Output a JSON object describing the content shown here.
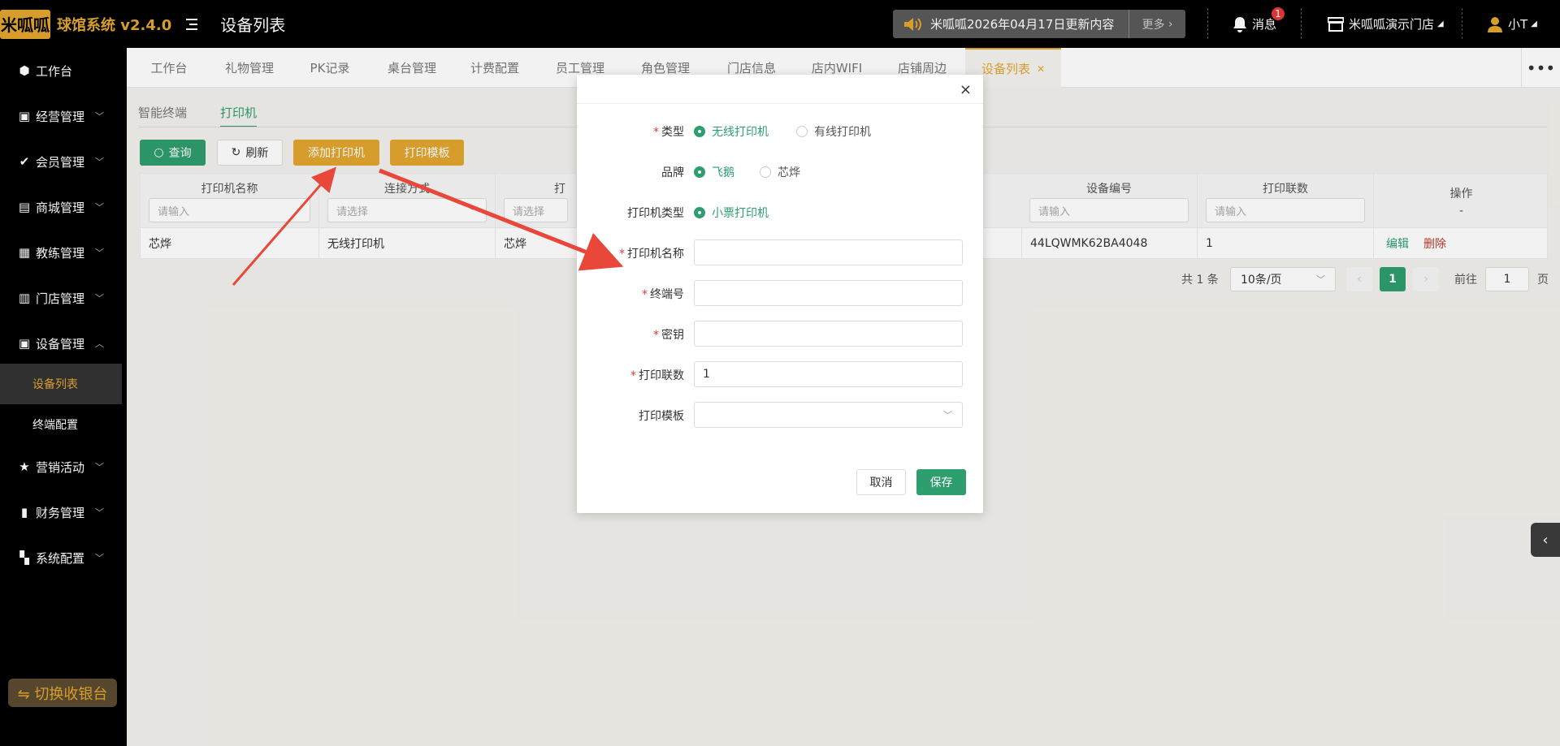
{
  "header": {
    "logo_text": "米呱呱",
    "app_title": "球馆系统 v2.4.0",
    "page_title": "设备列表",
    "notice_text": "米呱呱2026年04月17日更新内容",
    "notice_more": "更多",
    "messages_label": "消息",
    "messages_badge": "1",
    "store_label": "米呱呱演示门店",
    "user_label": "小T"
  },
  "sidebar": {
    "items": [
      {
        "label": "工作台",
        "icon": "cube-icon"
      },
      {
        "label": "经营管理",
        "icon": "chart-icon"
      },
      {
        "label": "会员管理",
        "icon": "member-icon"
      },
      {
        "label": "商城管理",
        "icon": "mall-icon"
      },
      {
        "label": "教练管理",
        "icon": "coach-icon"
      },
      {
        "label": "门店管理",
        "icon": "store-icon"
      },
      {
        "label": "设备管理",
        "icon": "device-icon"
      }
    ],
    "sub_items": [
      "设备列表",
      "终端配置"
    ],
    "items_after": [
      {
        "label": "营销活动",
        "icon": "star-icon"
      },
      {
        "label": "财务管理",
        "icon": "finance-icon"
      },
      {
        "label": "系统配置",
        "icon": "grid-icon"
      }
    ],
    "switch_label": "⇋ 切换收银台"
  },
  "tabs": [
    "工作台",
    "礼物管理",
    "PK记录",
    "桌台管理",
    "计费配置",
    "员工管理",
    "角色管理",
    "门店信息",
    "店内WIFI",
    "店铺周边",
    "设备列表"
  ],
  "subtabs": [
    "智能终端",
    "打印机"
  ],
  "toolbar": {
    "query": "查询",
    "refresh": "刷新",
    "add_printer": "添加打印机",
    "print_template": "打印模板"
  },
  "table": {
    "columns": [
      {
        "title": "打印机名称",
        "placeholder": "请输入"
      },
      {
        "title": "连接方式",
        "placeholder": "请选择"
      },
      {
        "title": "打印",
        "placeholder": "请选择"
      },
      {
        "title": "设备编号",
        "placeholder": "请输入"
      },
      {
        "title": "打印联数",
        "placeholder": "请输入"
      },
      {
        "title": "操作",
        "placeholder": "-"
      }
    ],
    "rows": [
      {
        "name": "芯烨",
        "connection": "无线打印机",
        "brand": "芯烨",
        "device_no": "44LQWMK62BA4048",
        "copies": "1",
        "edit": "编辑",
        "delete": "删除"
      }
    ]
  },
  "pagination": {
    "total": "共 1 条",
    "page_size": "10条/页",
    "current_page": "1",
    "goto_label": "前往",
    "goto_value": "1",
    "page_suffix": "页"
  },
  "modal": {
    "close": "×",
    "type_label": "类型",
    "type_options": [
      "无线打印机",
      "有线打印机"
    ],
    "brand_label": "品牌",
    "brand_options": [
      "飞鹅",
      "芯烨"
    ],
    "printer_type_label": "打印机类型",
    "printer_type_option": "小票打印机",
    "name_label": "打印机名称",
    "name_value": "",
    "terminal_label": "终端号",
    "terminal_value": "",
    "secret_label": "密钥",
    "secret_value": "",
    "copies_label": "打印联数",
    "copies_value": "1",
    "template_label": "打印模板",
    "template_value": "",
    "cancel": "取消",
    "save": "保存"
  },
  "colors": {
    "accent": "#e3a62f",
    "primary_green": "#2e9e6e",
    "danger": "#e53935",
    "arrow": "#e8473a"
  }
}
